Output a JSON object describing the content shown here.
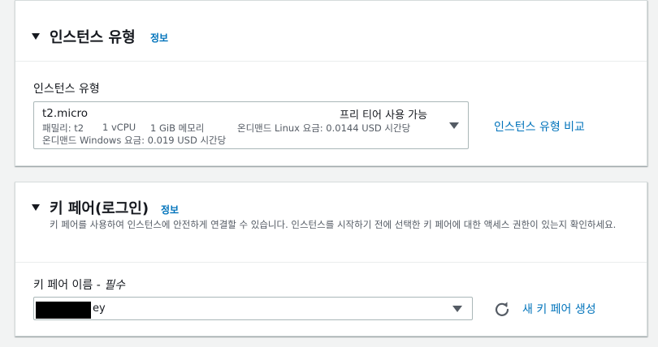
{
  "instance_type_section": {
    "title": "인스턴스 유형",
    "info_link": "정보",
    "field_label": "인스턴스 유형",
    "selected": {
      "name": "t2.micro",
      "tag": "프리 티어 사용 가능",
      "family": "패밀리: t2",
      "vcpu": "1 vCPU",
      "memory": "1 GiB 메모리",
      "linux_price": "온디맨드 Linux 요금: 0.0144 USD 시간당",
      "windows_price": "온디맨드 Windows 요금: 0.019 USD 시간당"
    },
    "compare_link": "인스턴스 유형 비교"
  },
  "key_pair_section": {
    "title": "키 페어(로그인)",
    "info_link": "정보",
    "description": "키 페어를 사용하여 인스턴스에 안전하게 연결할 수 있습니다. 인스턴스를 시작하기 전에 선택한 키 페어에 대한 액세스 권한이 있는지 확인하세요.",
    "field_label": "키 페어 이름 - ",
    "required_label": "필수",
    "selected_suffix": "ey",
    "create_link": "새 키 페어 생성"
  },
  "colors": {
    "link": "#0073bb",
    "background": "#f2f3f3",
    "border": "#aab7b8"
  },
  "icons": [
    "caret-down-icon",
    "refresh-icon"
  ]
}
